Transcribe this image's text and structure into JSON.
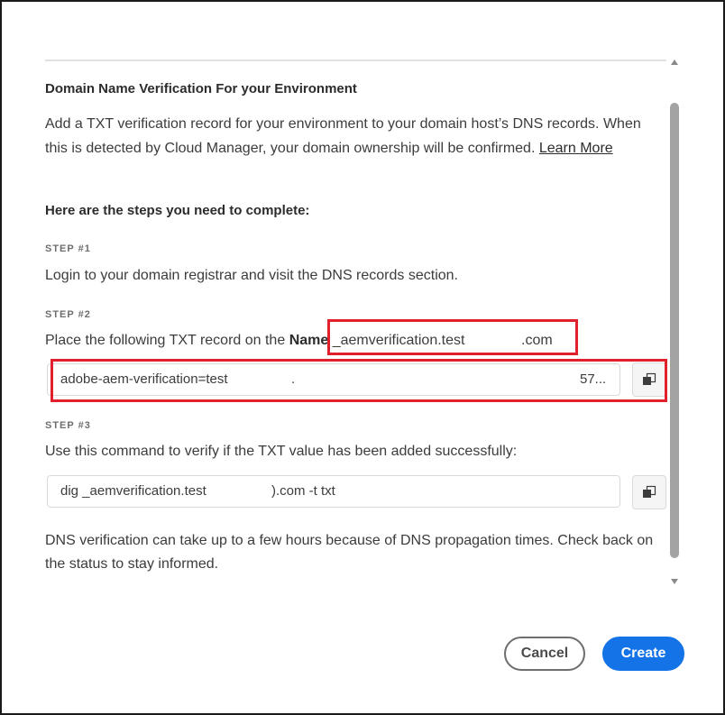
{
  "dialog": {
    "heading": "Domain Name Verification For your Environment",
    "description": "Add a TXT verification record for your environment to your domain host’s DNS records. When this is detected by Cloud Manager, your domain ownership will be confirmed.",
    "learn_more_label": "Learn More",
    "steps_heading": "Here are the steps you need to complete:",
    "steps": [
      {
        "label": "STEP #1",
        "text": "Login to your domain registrar and visit the DNS records section."
      },
      {
        "label": "STEP #2",
        "text": "Place the following TXT record on the",
        "name_label": "Name",
        "name_prefix": "_aemverification.test",
        "name_suffix": ".com",
        "record_value_start": "adobe-aem-verification=test",
        "record_value_mid": ".",
        "record_value_end": "57..."
      },
      {
        "label": "STEP #3",
        "text": "Use this command to verify if the TXT value has been added successfully:",
        "command_start": "dig _aemverification.test",
        "command_end": ").com -t txt"
      }
    ],
    "footer_note": "DNS verification can take up to a few hours because of DNS propagation times. Check back on the status to stay informed."
  },
  "buttons": {
    "cancel_label": "Cancel",
    "create_label": "Create"
  },
  "icons": {
    "copy": "copy-icon",
    "scroll_up": "chevron-up-icon",
    "scroll_down": "chevron-down-icon"
  },
  "colors": {
    "primary": "#1473e6",
    "highlight": "#e0212d",
    "border": "#d9d9d9"
  }
}
